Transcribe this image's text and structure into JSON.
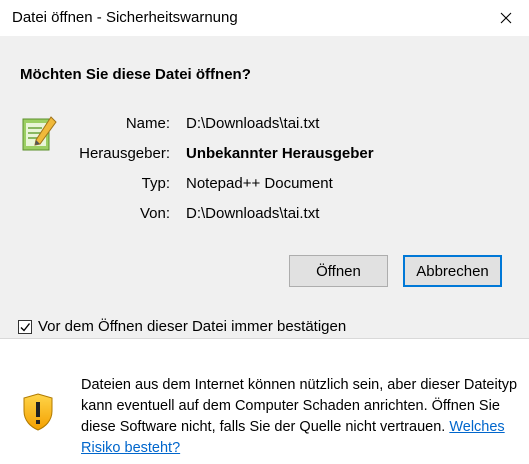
{
  "window": {
    "title": "Datei öffnen - Sicherheitswarnung"
  },
  "heading": "Möchten Sie diese Datei öffnen?",
  "file": {
    "icon": "notepad-plus-plus-icon",
    "fields": [
      {
        "label": "Name:",
        "value": "D:\\Downloads\\tai.txt"
      },
      {
        "label": "Herausgeber:",
        "value": "Unbekannter Herausgeber"
      },
      {
        "label": "Typ:",
        "value": "Notepad++ Document"
      },
      {
        "label": "Von:",
        "value": "D:\\Downloads\\tai.txt"
      }
    ]
  },
  "buttons": {
    "open": "Öffnen",
    "cancel": "Abbrechen"
  },
  "checkbox": {
    "label": "Vor dem Öffnen dieser Datei immer bestätigen",
    "checked": true
  },
  "warning": {
    "icon": "warning-shield-icon",
    "text": "Dateien aus dem Internet können nützlich sein, aber dieser Dateityp kann eventuell auf dem Computer Schaden anrichten. Öffnen Sie diese Software nicht, falls Sie der Quelle nicht vertrauen. ",
    "link": "Welches Risiko besteht?"
  },
  "colors": {
    "accent": "#0078d7",
    "link": "#0066cc",
    "panel_bg": "#f0f0f0"
  }
}
